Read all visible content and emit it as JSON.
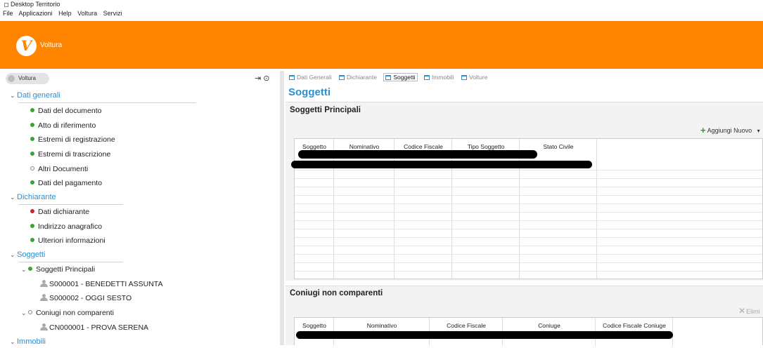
{
  "window": {
    "title": "Desktop Territorio"
  },
  "menu": [
    "File",
    "Applicazioni",
    "Help",
    "Voltura",
    "Servizi"
  ],
  "app": {
    "logo_letter": "V",
    "name": "Voltura",
    "accent": "#ff8400",
    "link_color": "#2b8fd1"
  },
  "left": {
    "crumb": "Voltura",
    "icons": [
      "collapse-panel-icon",
      "play-circle-icon"
    ],
    "sections": [
      {
        "label": "Dati generali",
        "items": [
          {
            "label": "Dati del documento",
            "status": "green"
          },
          {
            "label": "Atto di riferimento",
            "status": "green"
          },
          {
            "label": "Estremi di registrazione",
            "status": "green"
          },
          {
            "label": "Estremi di trascrizione",
            "status": "green"
          },
          {
            "label": "Altri Documenti",
            "status": "empty"
          },
          {
            "label": "Dati del pagamento",
            "status": "green"
          }
        ]
      },
      {
        "label": "Dichiarante",
        "items": [
          {
            "label": "Dati dichiarante",
            "status": "red"
          },
          {
            "label": "Indirizzo anagrafico",
            "status": "green"
          },
          {
            "label": "Ulteriori informazioni",
            "status": "green"
          }
        ]
      },
      {
        "label": "Soggetti",
        "groups": [
          {
            "label": "Soggetti Principali",
            "status": "green",
            "children": [
              "S000001 - BENEDETTI ASSUNTA",
              "S000002 - OGGI SESTO"
            ]
          },
          {
            "label": "Coniugi non comparenti",
            "status": "empty",
            "children": [
              "CN000001 - PROVA SERENA"
            ]
          }
        ]
      },
      {
        "label": "Immobili"
      }
    ]
  },
  "tabs": [
    {
      "label": "Dati Generali",
      "active": false
    },
    {
      "label": "Dichiarante",
      "active": false
    },
    {
      "label": "Soggetti",
      "active": true
    },
    {
      "label": "Immobili",
      "active": false
    },
    {
      "label": "Volture",
      "active": false
    }
  ],
  "page_title": "Soggetti",
  "principali": {
    "title": "Soggetti Principali",
    "add_label": "Aggiungi Nuovo",
    "columns": [
      "Soggetto",
      "Nominativo",
      "Codice Fiscale",
      "Tipo Soggetto",
      "Stato Civile"
    ]
  },
  "coniugi": {
    "title": "Coniugi non comparenti",
    "delete_label": "Elimi",
    "columns": [
      "Soggetto",
      "Nominativo",
      "Codice Fiscale",
      "Coniuge",
      "Codice Fiscale Coniuge"
    ]
  }
}
